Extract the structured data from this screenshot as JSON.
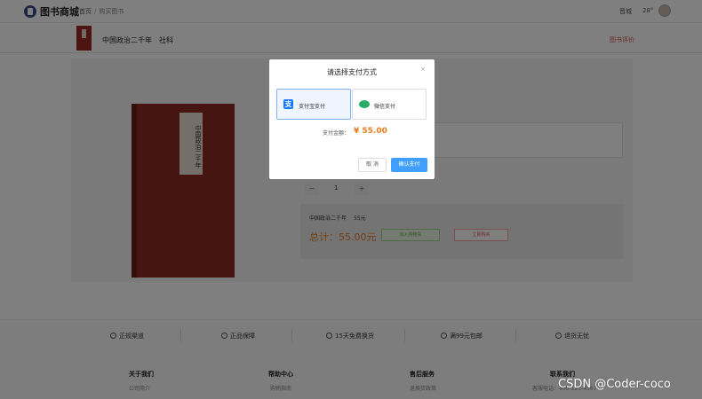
{
  "topnav": {
    "logo_text": "图书商城",
    "breadcrumb_home": "首页",
    "breadcrumb_current": "购买图书",
    "weather_city": "晋城",
    "weather_temp": "28°"
  },
  "product_bar": {
    "title": "中国政治二千年",
    "category": "社科",
    "reviews_link": "图书评价"
  },
  "product": {
    "book_cover_text": "中国政治二千年",
    "quantity": "1",
    "summary_name": "中国政治二千年",
    "summary_price": "55元",
    "total": "总计：55.00元",
    "add_to_cart": "加入购物车",
    "buy_now": "立即购买"
  },
  "services": {
    "items": [
      "正规渠道",
      "正品保障",
      "15天免费换货",
      "满99元包邮",
      "退货无忧"
    ]
  },
  "footer": {
    "columns": [
      "关于我们",
      "帮助中心",
      "售后服务",
      "联系我们"
    ],
    "subs": [
      "公司简介",
      "购物指南",
      "退换货政策",
      "客服电话：400-123-4567"
    ]
  },
  "watermark": "CSDN @Coder-coco",
  "modal": {
    "title": "请选择支付方式",
    "close_symbol": "×",
    "options": [
      {
        "label": "支付宝支付",
        "selected": true
      },
      {
        "label": "微信支付",
        "selected": false
      }
    ],
    "amount_label": "支付金额：",
    "amount_value": "¥ 55.00",
    "cancel": "取 消",
    "confirm": "确认支付"
  },
  "colors": {
    "accent_blue": "#409eff",
    "price_orange": "#e67e22",
    "alipay_blue": "#1677ff",
    "wechat_green": "#2aae67"
  }
}
